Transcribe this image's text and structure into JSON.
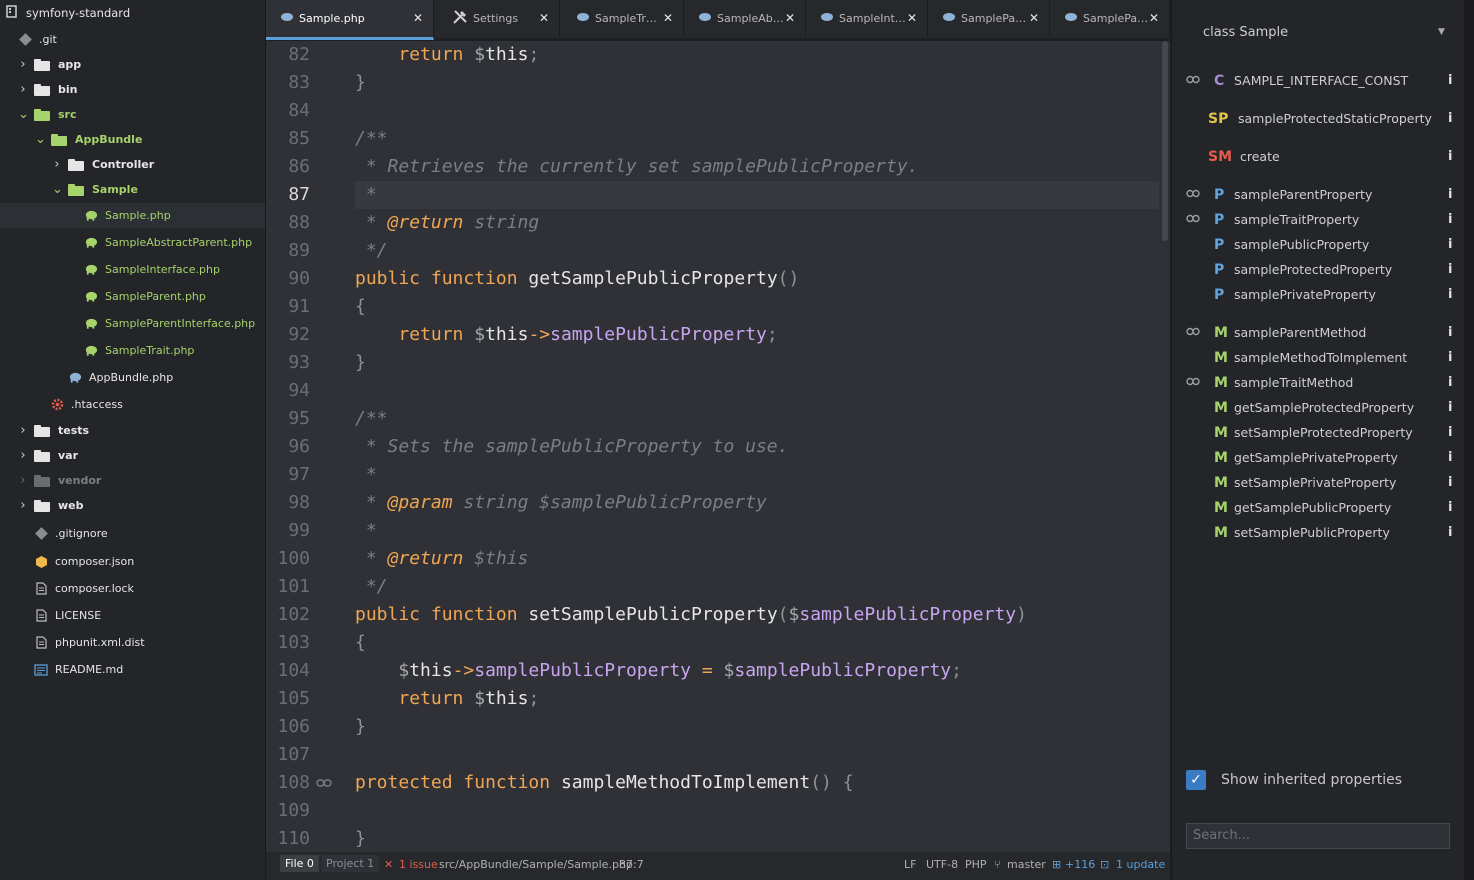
{
  "tree": {
    "root": "symfony-standard",
    "items": [
      {
        "label": ".git",
        "type": "git"
      },
      {
        "label": "app",
        "type": "folder"
      },
      {
        "label": "bin",
        "type": "folder"
      },
      {
        "label": "src",
        "type": "folder-green"
      },
      {
        "label": "AppBundle",
        "type": "folder-green"
      },
      {
        "label": "Controller",
        "type": "folder"
      },
      {
        "label": "Sample",
        "type": "folder-green"
      },
      {
        "label": "Sample.php",
        "type": "php-green"
      },
      {
        "label": "SampleAbstractParent.php",
        "type": "php-green"
      },
      {
        "label": "SampleInterface.php",
        "type": "php-green"
      },
      {
        "label": "SampleParent.php",
        "type": "php-green"
      },
      {
        "label": "SampleParentInterface.php",
        "type": "php-green"
      },
      {
        "label": "SampleTrait.php",
        "type": "php-green"
      },
      {
        "label": "AppBundle.php",
        "type": "php"
      },
      {
        "label": ".htaccess",
        "type": "config"
      },
      {
        "label": "tests",
        "type": "folder"
      },
      {
        "label": "var",
        "type": "folder"
      },
      {
        "label": "vendor",
        "type": "folder-dim"
      },
      {
        "label": "web",
        "type": "folder"
      },
      {
        "label": ".gitignore",
        "type": "git"
      },
      {
        "label": "composer.json",
        "type": "composer"
      },
      {
        "label": "composer.lock",
        "type": "file"
      },
      {
        "label": "LICENSE",
        "type": "file"
      },
      {
        "label": "phpunit.xml.dist",
        "type": "file"
      },
      {
        "label": "README.md",
        "type": "readme"
      }
    ]
  },
  "tabs": [
    {
      "label": "Sample.php",
      "icon": "php-elephant-icon"
    },
    {
      "label": "Settings",
      "icon": "tools-icon"
    },
    {
      "label": "SampleTr…",
      "icon": "php-elephant-icon"
    },
    {
      "label": "SampleAb…",
      "icon": "php-elephant-icon"
    },
    {
      "label": "SampleInt…",
      "icon": "php-elephant-icon"
    },
    {
      "label": "SamplePa…",
      "icon": "php-elephant-icon"
    },
    {
      "label": "SamplePa…",
      "icon": "php-elephant-icon"
    }
  ],
  "editor": {
    "line_numbers": [
      "82",
      "83",
      "84",
      "85",
      "86",
      "87",
      "88",
      "89",
      "90",
      "91",
      "92",
      "93",
      "94",
      "95",
      "96",
      "97",
      "98",
      "99",
      "100",
      "101",
      "102",
      "103",
      "104",
      "105",
      "106",
      "107",
      "108",
      "109",
      "110"
    ],
    "current_line": "87"
  },
  "status": {
    "file": "File 0",
    "project": "Project 1",
    "issues": "1 issue",
    "path": "src/AppBundle/Sample/Sample.php",
    "cursor": "87:7",
    "eol": "LF",
    "encoding": "UTF-8",
    "grammar": "PHP",
    "branch": "master",
    "diff": "+116",
    "updates": "1 update"
  },
  "outline": {
    "title": "class Sample",
    "items": [
      {
        "badge": "C",
        "name": "SAMPLE_INTERFACE_CONST",
        "inherited": true
      },
      {
        "badge": "SP",
        "name": "sampleProtectedStaticProperty",
        "inherited": false
      },
      {
        "badge": "SM",
        "name": "create",
        "inherited": false
      },
      {
        "badge": "P",
        "name": "sampleParentProperty",
        "inherited": true
      },
      {
        "badge": "P",
        "name": "sampleTraitProperty",
        "inherited": true
      },
      {
        "badge": "P",
        "name": "samplePublicProperty",
        "inherited": false
      },
      {
        "badge": "P",
        "name": "sampleProtectedProperty",
        "inherited": false
      },
      {
        "badge": "P",
        "name": "samplePrivateProperty",
        "inherited": false
      },
      {
        "badge": "M",
        "name": "sampleParentMethod",
        "inherited": true
      },
      {
        "badge": "M",
        "name": "sampleMethodToImplement",
        "inherited": false
      },
      {
        "badge": "M",
        "name": "sampleTraitMethod",
        "inherited": true
      },
      {
        "badge": "M",
        "name": "getSampleProtectedProperty",
        "inherited": false
      },
      {
        "badge": "M",
        "name": "setSampleProtectedProperty",
        "inherited": false
      },
      {
        "badge": "M",
        "name": "getSamplePrivateProperty",
        "inherited": false
      },
      {
        "badge": "M",
        "name": "setSamplePrivateProperty",
        "inherited": false
      },
      {
        "badge": "M",
        "name": "getSamplePublicProperty",
        "inherited": false
      },
      {
        "badge": "M",
        "name": "setSamplePublicProperty",
        "inherited": false
      }
    ],
    "info_label": "i",
    "checkbox_label": "Show inherited properties",
    "checkbox_checked": true,
    "search_placeholder": "Search..."
  },
  "colors": {
    "accent": "#5c9fd8",
    "keyword": "#f0a653",
    "variable": "#c9a4ef",
    "tree_green": "#a6d36b",
    "error": "#e45c4c"
  }
}
